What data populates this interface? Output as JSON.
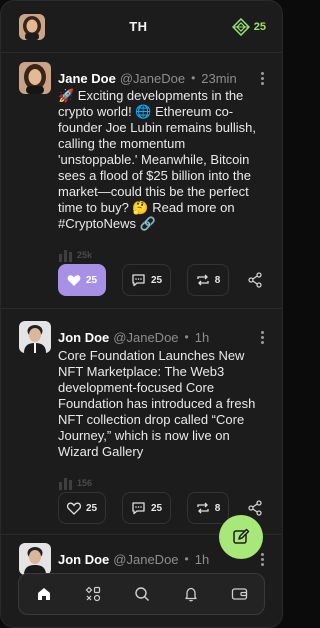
{
  "header": {
    "title": "TH",
    "points": "25"
  },
  "posts": [
    {
      "author": "Jane Doe",
      "handle": "@JaneDoe",
      "separator": "•",
      "time": "23min",
      "text": "🚀 Exciting developments in the crypto world! 🌐 Ethereum co-founder Joe Lubin remains bullish, calling the momentum 'unstoppable.' Meanwhile, Bitcoin sees a flood of $25 billion into the market—could this be the perfect time to buy? 🤔 Read more on #CryptoNews 🔗",
      "views": "25k",
      "likes": "25",
      "comments": "25",
      "reposts": "8",
      "liked": true
    },
    {
      "author": "Jon Doe",
      "handle": "@JaneDoe",
      "separator": "•",
      "time": "1h",
      "text": "Core Foundation Launches New NFT Marketplace: The Web3 development-focused Core Foundation has introduced a fresh NFT collection drop called “Core Journey,” which is now live on Wizard Gallery",
      "views": "156",
      "likes": "25",
      "comments": "25",
      "reposts": "8",
      "liked": false
    },
    {
      "author": "Jon Doe",
      "handle": "@JaneDoe",
      "separator": "•",
      "time": "1h"
    }
  ],
  "nav": {
    "items": [
      "home-icon",
      "apps-icon",
      "search-icon",
      "bell-icon",
      "wallet-icon"
    ],
    "active": "home-icon"
  },
  "colors": {
    "accent_like": "#a790e6",
    "accent_green": "#a8e878",
    "background": "#1c1c1c"
  }
}
